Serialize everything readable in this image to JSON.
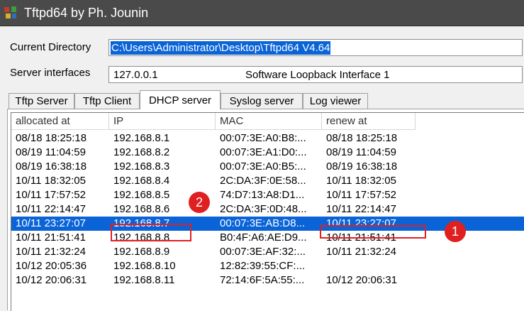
{
  "window": {
    "title": "Tftpd64 by Ph. Jounin",
    "icon": "tftpd-app-icon"
  },
  "current_directory": {
    "label": "Current Directory",
    "value": "C:\\Users\\Administrator\\Desktop\\Tftpd64 V4.64"
  },
  "server_interfaces": {
    "label": "Server interfaces",
    "ip": "127.0.0.1",
    "description": "Software Loopback Interface 1"
  },
  "tabs": [
    {
      "label": "Tftp Server",
      "active": false
    },
    {
      "label": "Tftp Client",
      "active": false
    },
    {
      "label": "DHCP server",
      "active": true
    },
    {
      "label": "Syslog server",
      "active": false
    },
    {
      "label": "Log viewer",
      "active": false
    }
  ],
  "table": {
    "columns": [
      "allocated at",
      "IP",
      "MAC",
      "renew at"
    ],
    "rows": [
      [
        "08/18 18:25:18",
        "192.168.8.1",
        "00:07:3E:A0:B8:...",
        "08/18 18:25:18"
      ],
      [
        "08/19 11:04:59",
        "192.168.8.2",
        "00:07:3E:A1:D0:...",
        "08/19 11:04:59"
      ],
      [
        "08/19 16:38:18",
        "192.168.8.3",
        "00:07:3E:A0:B5:...",
        "08/19 16:38:18"
      ],
      [
        "10/11 18:32:05",
        "192.168.8.4",
        "2C:DA:3F:0E:58...",
        "10/11 18:32:05"
      ],
      [
        "10/11 17:57:52",
        "192.168.8.5",
        "74:D7:13:A8:D1...",
        "10/11 17:57:52"
      ],
      [
        "10/11 22:14:47",
        "192.168.8.6",
        "2C:DA:3F:0D:48...",
        "10/11 22:14:47"
      ],
      [
        "10/11 23:27:07",
        "192.168.8.7",
        "00:07:3E:AB:D8...",
        "10/11 23:27:07"
      ],
      [
        "10/11 21:51:41",
        "192.168.8.8",
        "B0:4F:A6:AE:D9...",
        "10/11 21:51:41"
      ],
      [
        "10/11 21:32:24",
        "192.168.8.9",
        "00:07:3E:AF:32:...",
        "10/11 21:32:24"
      ],
      [
        "10/12 20:05:36",
        "192.168.8.10",
        "12:82:39:55:CF:...",
        ""
      ],
      [
        "10/12 20:06:31",
        "192.168.8.11",
        "72:14:6F:5A:55:...",
        "10/12 20:06:31"
      ]
    ],
    "selected_row": 6
  },
  "annotations": {
    "badge1": "1",
    "badge2": "2",
    "color": "#e02020"
  },
  "colors": {
    "selection": "#0a64d8",
    "titlebar": "#4a4a4a"
  }
}
